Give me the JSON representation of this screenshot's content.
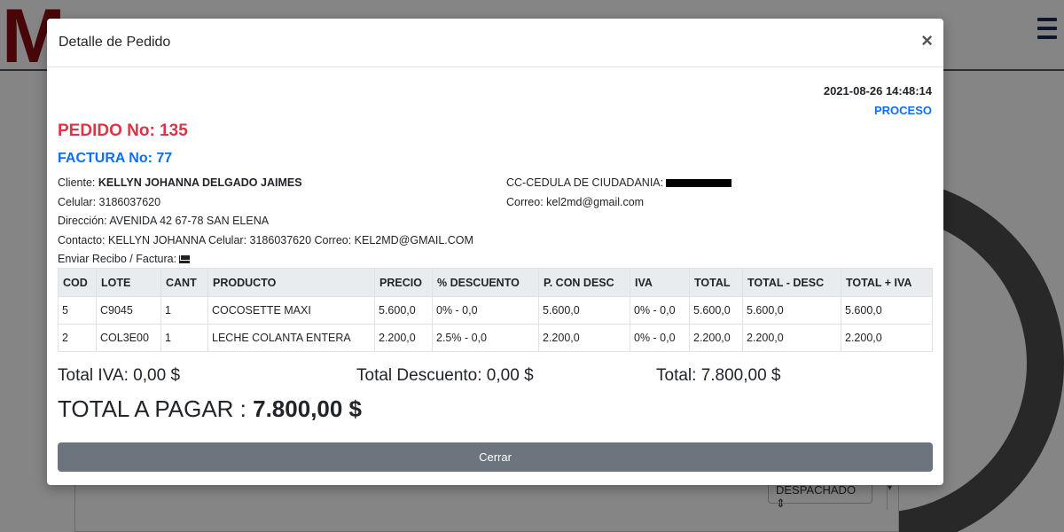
{
  "modal": {
    "title": "Detalle de Pedido",
    "close_symbol": "×",
    "datetime": "2021-08-26 14:48:14",
    "status": "PROCESO",
    "pedido_label": "PEDIDO No: 135",
    "factura_label": "FACTURA No: 77",
    "cliente_label": "Cliente:",
    "cliente_name": "KELLYN JOHANNA DELGADO JAIMES",
    "cedula_label": "CC-CEDULA DE CIUDADANIA:",
    "celular": "Celular: 3186037620",
    "correo": "Correo: kel2md@gmail.com",
    "direccion": "Dirección: AVENIDA 42 67-78 SAN ELENA",
    "contacto": "Contacto: KELLYN JOHANNA Celular: 3186037620 Correo: KEL2MD@GMAIL.COM",
    "enviar_recibo": "Enviar Recibo / Factura:",
    "table": {
      "headers": [
        "COD",
        "LOTE",
        "CANT",
        "PRODUCTO",
        "PRECIO",
        "% DESCUENTO",
        "P. CON DESC",
        "IVA",
        "TOTAL",
        "TOTAL - DESC",
        "TOTAL + IVA"
      ],
      "rows": [
        [
          "5",
          "C9045",
          "1",
          "COCOSETTE MAXI",
          "5.600,0",
          "0% - 0,0",
          "5.600,0",
          "0% - 0,0",
          "5.600,0",
          "5.600,0",
          "5.600,0"
        ],
        [
          "2",
          "COL3E00",
          "1",
          "LECHE COLANTA ENTERA",
          "2.200,0",
          "2.5% - 0,0",
          "2.200,0",
          "0% - 0,0",
          "2.200,0",
          "2.200,0",
          "2.200,0"
        ]
      ]
    },
    "total_iva": "Total IVA: 0,00 $",
    "total_descuento": "Total Descuento: 0,00 $",
    "total": "Total: 7.800,00 $",
    "total_pagar_label": "TOTAL A PAGAR :",
    "total_pagar_value": "7.800,00 $",
    "close_button": "Cerrar"
  },
  "background": {
    "logo_letter": "M",
    "select_value": "DESPACHADO"
  }
}
